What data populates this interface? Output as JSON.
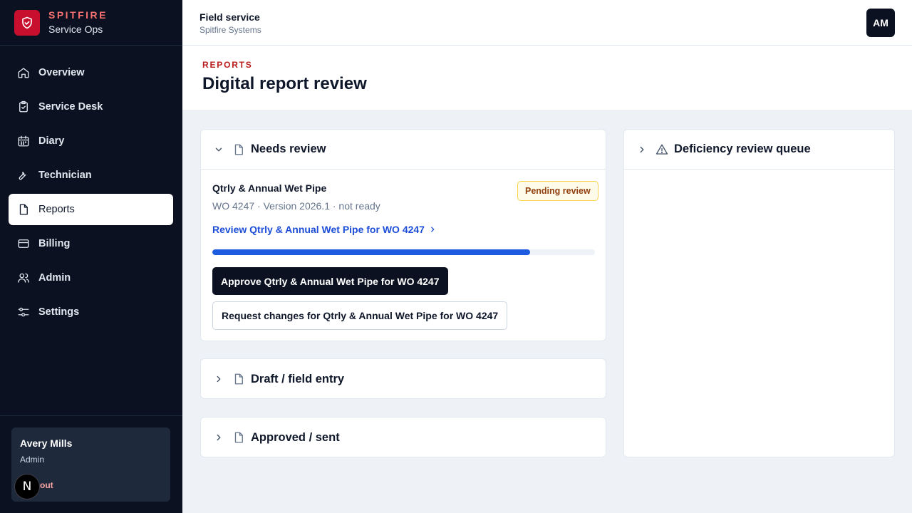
{
  "brand": {
    "name": "SPITFIRE",
    "subtitle": "Service Ops"
  },
  "nav": {
    "items": [
      {
        "label": "Overview",
        "icon": "home-icon",
        "active": false
      },
      {
        "label": "Service Desk",
        "icon": "clipboard-check-icon",
        "active": false
      },
      {
        "label": "Diary",
        "icon": "calendar-icon",
        "active": false
      },
      {
        "label": "Technician",
        "icon": "wrench-icon",
        "active": false
      },
      {
        "label": "Reports",
        "icon": "file-icon",
        "active": true
      },
      {
        "label": "Billing",
        "icon": "credit-card-icon",
        "active": false
      },
      {
        "label": "Admin",
        "icon": "users-icon",
        "active": false
      },
      {
        "label": "Settings",
        "icon": "sliders-icon",
        "active": false
      }
    ]
  },
  "user": {
    "name": "Avery Mills",
    "role": "Admin",
    "signout_visible": "out",
    "overlay_badge": "N"
  },
  "topbar": {
    "title": "Field service",
    "subtitle": "Spitfire Systems",
    "avatar": "AM"
  },
  "page": {
    "eyebrow": "REPORTS",
    "title": "Digital report review"
  },
  "needs_review": {
    "title": "Needs review",
    "expanded": true,
    "report": {
      "title": "Qtrly & Annual Wet Pipe",
      "meta": "WO 4247 · Version 2026.1 · not ready",
      "status": "Pending review",
      "review_link": "Review Qtrly & Annual Wet Pipe for WO 4247",
      "progress_percent": 83,
      "approve_label": "Approve Qtrly & Annual Wet Pipe for WO 4247",
      "request_changes_label": "Request changes for Qtrly & Annual Wet Pipe for WO 4247"
    }
  },
  "draft": {
    "title": "Draft / field entry",
    "expanded": false
  },
  "approved": {
    "title": "Approved / sent",
    "expanded": false
  },
  "deficiency": {
    "title": "Deficiency review queue",
    "expanded": false
  },
  "colors": {
    "brand_red": "#c8102e",
    "sidebar_bg": "#0b1120",
    "link_blue": "#1d4ed8",
    "progress_blue": "#1d5be0",
    "pending_bg": "#fffbeb"
  }
}
